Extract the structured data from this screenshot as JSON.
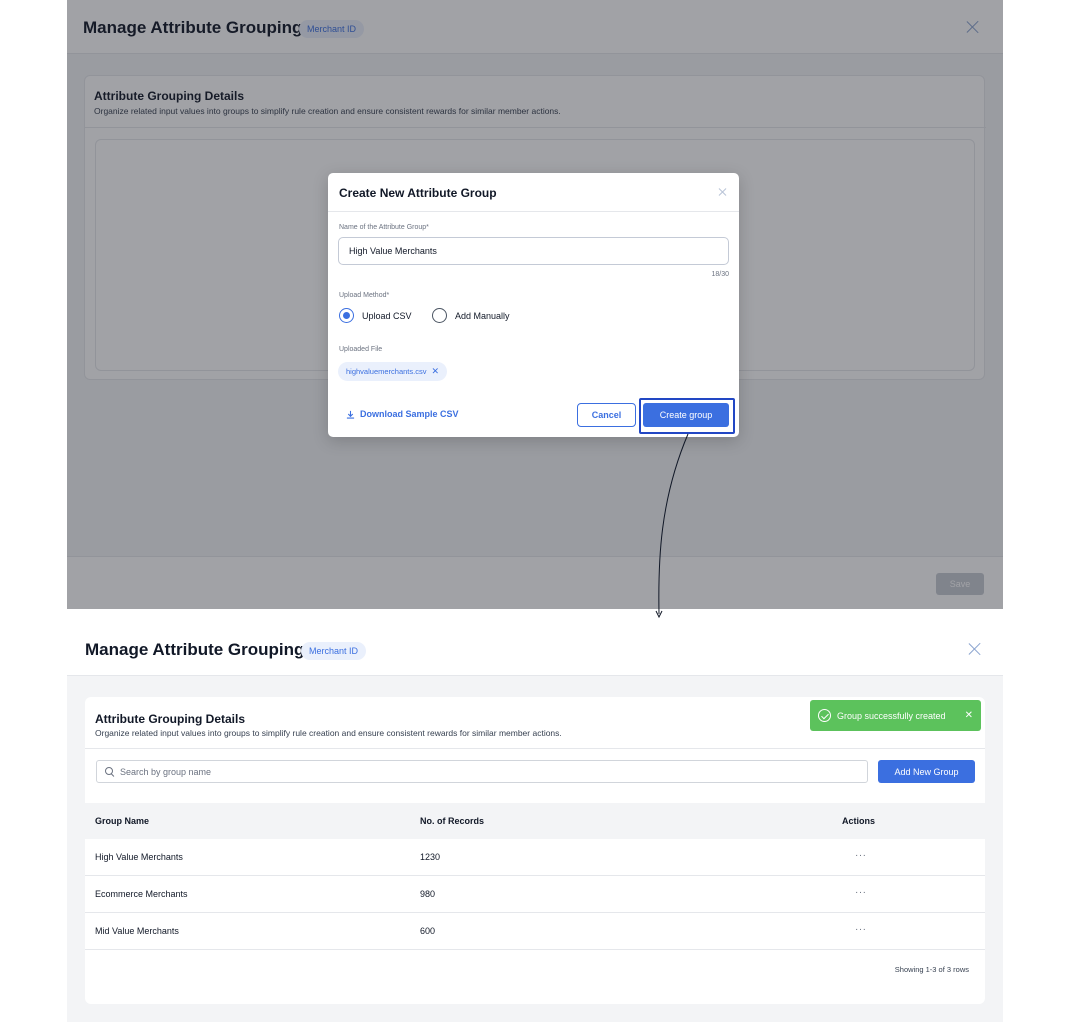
{
  "top": {
    "header": {
      "title": "Manage Attribute Grouping",
      "badge": "Merchant ID"
    },
    "card": {
      "title": "Attribute Grouping Details",
      "description": "Organize related input values into groups to simplify rule creation and ensure consistent rewards for similar member actions."
    },
    "footer": {
      "save_label": "Save"
    }
  },
  "modal": {
    "title": "Create New Attribute Group",
    "name_label": "Name of the Attribute Group*",
    "name_value": "High Value Merchants",
    "counter": "18/30",
    "upload_label": "Upload Method*",
    "option_csv": "Upload CSV",
    "option_manual": "Add Manually",
    "selected_option": "Upload CSV",
    "file_label": "Uploaded File",
    "file_name": "highvaluemerchants.csv",
    "download_label": "Download Sample CSV",
    "cancel_label": "Cancel",
    "create_label": "Create group"
  },
  "bottom": {
    "header": {
      "title": "Manage Attribute Grouping",
      "badge": "Merchant ID"
    },
    "card": {
      "title": "Attribute Grouping Details",
      "description": "Organize related input values into groups to simplify rule creation and ensure consistent rewards for similar member actions."
    },
    "toast": "Group successfully created",
    "search": {
      "placeholder": "Search by group name"
    },
    "add_button": "Add New Group",
    "table": {
      "columns": [
        "Group Name",
        "No. of Records",
        "Actions"
      ],
      "rows": [
        {
          "name": "High Value Merchants",
          "records": "1230",
          "actions": "···"
        },
        {
          "name": "Ecommerce Merchants",
          "records": "980",
          "actions": "···"
        },
        {
          "name": "Mid Value Merchants",
          "records": "600",
          "actions": "···"
        }
      ],
      "footer": "Showing 1-3 of 3 rows"
    }
  },
  "colors": {
    "accent": "#3b6fe0",
    "success": "#5cc25c",
    "highlight": "#2247c4"
  }
}
